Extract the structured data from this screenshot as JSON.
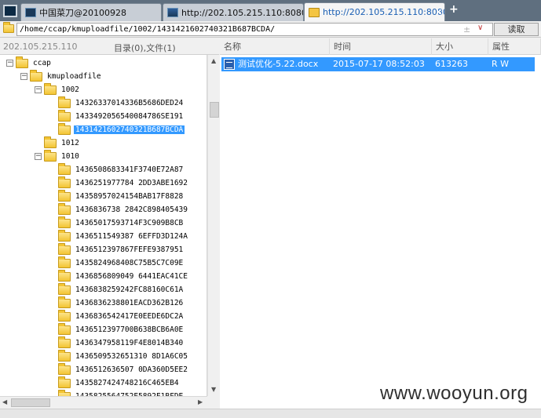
{
  "tabs": [
    {
      "label": "中国菜刀@20100928",
      "active": false
    },
    {
      "label": "http://202.105.215.110:8080...",
      "active": false
    },
    {
      "label": "http://202.105.215.110:8080...",
      "active": true
    }
  ],
  "new_tab_label": "+",
  "close_label": "×",
  "path": {
    "value": "/home/ccap/kmuploadfile/1002/1431421602740321B687BCDA/",
    "sort_glyph": "±",
    "dropdown_glyph": "∨",
    "read_button": "读取"
  },
  "left_panel": {
    "server_ip": "202.105.215.110",
    "summary": "目录(0),文件(1)"
  },
  "tree": [
    {
      "label": "ccap",
      "level": 0,
      "expander": "−"
    },
    {
      "label": "kmuploadfile",
      "level": 1,
      "expander": "−"
    },
    {
      "label": "1002",
      "level": 2,
      "expander": "−"
    },
    {
      "label": "14326337014336B5686DED24",
      "level": 3
    },
    {
      "label": "1433492056540084786SE191",
      "level": 3
    },
    {
      "label": "1431421602740321B687BCDA",
      "level": 3,
      "selected": true
    },
    {
      "label": "1012",
      "level": 2
    },
    {
      "label": "1010",
      "level": 2,
      "expander": "−"
    },
    {
      "label": "1436508683341F3740E72A87",
      "level": 3
    },
    {
      "label": "1436251977784 2DD3ABE1692",
      "level": 3
    },
    {
      "label": "14358957024154BAB17F8828",
      "level": 3
    },
    {
      "label": "1436836738 2842C898405439",
      "level": 3
    },
    {
      "label": "14365017593714F3C909B8CB",
      "level": 3
    },
    {
      "label": "1436511549387 6EFFD3D124A",
      "level": 3
    },
    {
      "label": "1436512397867FEFE9387951",
      "level": 3
    },
    {
      "label": "1435824968408C75B5C7C09E",
      "level": 3
    },
    {
      "label": "1436856809049 6441EAC41CE",
      "level": 3
    },
    {
      "label": "1436838259242FC88160C61A",
      "level": 3
    },
    {
      "label": "1436836238801EACD362B126",
      "level": 3
    },
    {
      "label": "1436836542417E0EEDE6DC2A",
      "level": 3
    },
    {
      "label": "1436512397700B638BCB6A0E",
      "level": 3
    },
    {
      "label": "1436347958119F4E8014B340",
      "level": 3
    },
    {
      "label": "1436509532651310 8D1A6C05",
      "level": 3
    },
    {
      "label": "1436512636507 0DA360D5EE2",
      "level": 3
    },
    {
      "label": "1435827424748216C465EB4",
      "level": 3
    },
    {
      "label": "1435825564752E5892E1BFDE",
      "level": 3
    }
  ],
  "columns": {
    "name": "名称",
    "time": "时间",
    "size": "大小",
    "attr": "属性"
  },
  "files": [
    {
      "name": "测试优化-5.22.docx",
      "time": "2015-07-17 08:52:03",
      "size": "613263",
      "attr": "R W",
      "icon": "word-doc-icon"
    }
  ],
  "watermark": "www.wooyun.org",
  "colors": {
    "selection": "#3399ff",
    "tabbar": "#5f6f7f"
  }
}
